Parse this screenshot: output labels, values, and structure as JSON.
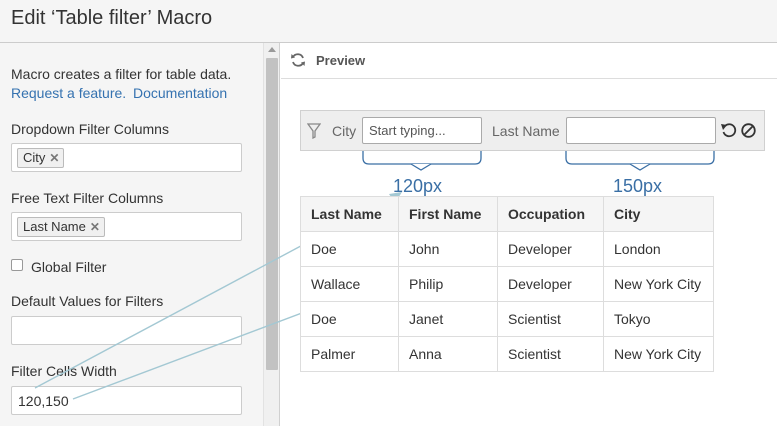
{
  "title": "Edit ‘Table filter’ Macro",
  "left": {
    "description": "Macro creates a filter for table data.",
    "links": {
      "request": "Request a feature.",
      "docs": "Documentation"
    },
    "dropdown_label": "Dropdown Filter Columns",
    "dropdown_tag": "City",
    "freetext_label": "Free Text Filter Columns",
    "freetext_tag": "Last Name",
    "global_filter_label": "Global Filter",
    "default_values_label": "Default Values for Filters",
    "default_values_value": "",
    "cell_width_label": "Filter Cells Width",
    "cell_width_value": "120,150"
  },
  "preview": {
    "label": "Preview",
    "filter": {
      "city_label": "City",
      "city_placeholder": "Start typing...",
      "lastname_label": "Last Name",
      "lastname_value": ""
    },
    "annotations": {
      "w1": "120px",
      "w2": "150px"
    },
    "table": {
      "headers": [
        "Last Name",
        "First Name",
        "Occupation",
        "City"
      ],
      "rows": [
        [
          "Doe",
          "John",
          "Developer",
          "London"
        ],
        [
          "Wallace",
          "Philip",
          "Developer",
          "New York City"
        ],
        [
          "Doe",
          "Janet",
          "Scientist",
          "Tokyo"
        ],
        [
          "Palmer",
          "Anna",
          "Scientist",
          "New York City"
        ]
      ]
    }
  },
  "colors": {
    "link": "#3572b0",
    "annotation": "#3a6fa5",
    "arrow": "#a3c8d3"
  },
  "icons": [
    "refresh-icon",
    "filter-icon",
    "undo-icon",
    "clear-icon",
    "tag-remove-icon"
  ]
}
